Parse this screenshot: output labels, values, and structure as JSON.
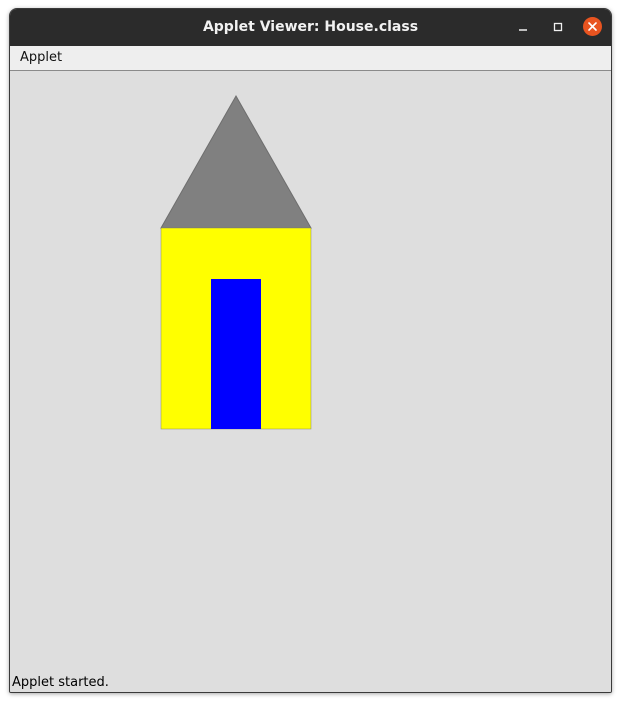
{
  "window": {
    "title": "Applet Viewer: House.class",
    "controls": {
      "minimize_icon": "minimize-icon",
      "maximize_icon": "maximize-icon",
      "close_icon": "close-icon",
      "close_color": "#e95420"
    }
  },
  "menubar": {
    "items": [
      {
        "label": "Applet"
      }
    ]
  },
  "drawing": {
    "roof_color": "#808080",
    "wall_color": "#ffff00",
    "door_color": "#0000ff",
    "background_color": "#dedede"
  },
  "status": {
    "text": "Applet started."
  }
}
